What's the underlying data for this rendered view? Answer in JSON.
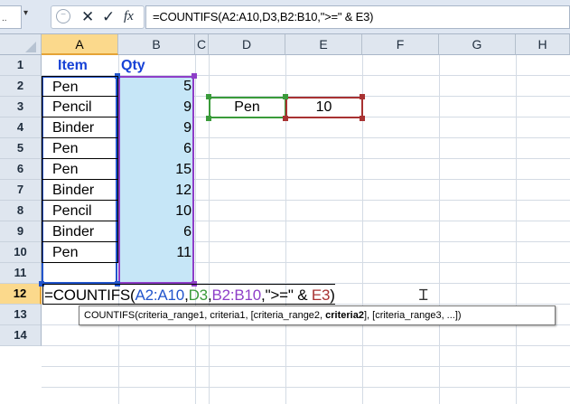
{
  "formula_bar": {
    "name_box": "..",
    "dropdown_glyph": "▾",
    "cancel_glyph": "✕",
    "enter_glyph": "✓",
    "fx_glyph": "fx",
    "formula": "=COUNTIFS(A2:A10,D3,B2:B10,\">=\" & E3)"
  },
  "columns": [
    "A",
    "B",
    "C",
    "D",
    "E",
    "F",
    "G",
    "H"
  ],
  "rows": [
    "1",
    "2",
    "3",
    "4",
    "5",
    "6",
    "7",
    "8",
    "9",
    "10",
    "11",
    "12",
    "13",
    "14"
  ],
  "cells": {
    "A1": "Item",
    "B1": "Qty",
    "A2": "Pen",
    "B2": "5",
    "A3": "Pencil",
    "B3": "9",
    "A4": "Binder",
    "B4": "9",
    "A5": "Pen",
    "B5": "6",
    "A6": "Pen",
    "B6": "15",
    "A7": "Binder",
    "B7": "12",
    "A8": "Pencil",
    "B8": "10",
    "A9": "Binder",
    "B9": "6",
    "A10": "Pen",
    "B10": "11",
    "D3": "Pen",
    "E3": "10"
  },
  "editing": {
    "prefix": "=COUNTIFS(",
    "arg1": "A2:A10",
    "comma1": ",",
    "arg2": "D3",
    "comma2": ",",
    "arg3": "B2:B10",
    "mid": ",\">=\" & ",
    "arg4": "E3",
    "close": ")"
  },
  "tooltip": {
    "func": "COUNTIFS(",
    "p1": "criteria_range1, criteria1, [criteria_range2, ",
    "p2": "criteria2",
    "p3": "], [criteria_range3, ...])"
  },
  "colors": {
    "range_a": "#2255cc",
    "range_d": "#3a9b3a",
    "range_b": "#8e3fc8",
    "range_e": "#a83232"
  }
}
